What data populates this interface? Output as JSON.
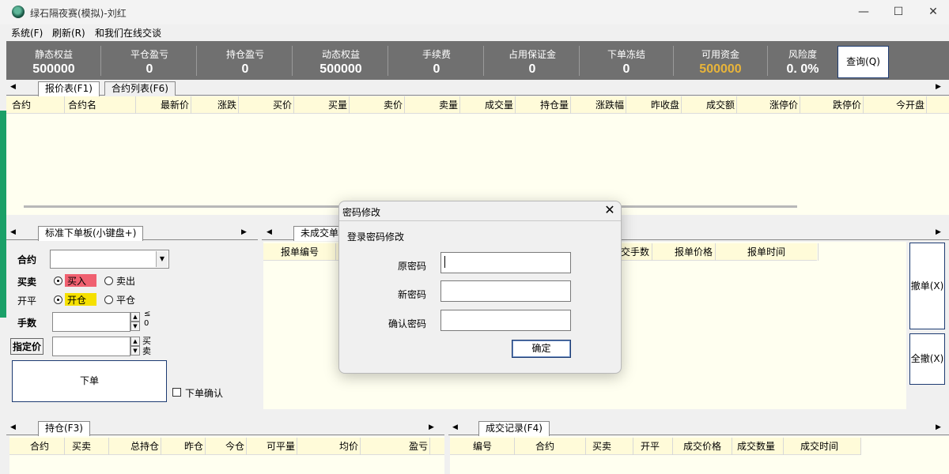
{
  "window": {
    "title": "绿石隔夜赛(模拟)-刘红",
    "minimize": "—",
    "maximize": "☐",
    "close": "✕"
  },
  "menu": [
    "系统(F)",
    "刷新(R)",
    "和我们在线交谈"
  ],
  "stats": [
    {
      "label": "静态权益",
      "value": "500000"
    },
    {
      "label": "平仓盈亏",
      "value": "0"
    },
    {
      "label": "持仓盈亏",
      "value": "0"
    },
    {
      "label": "动态权益",
      "value": "500000"
    },
    {
      "label": "手续费",
      "value": "0"
    },
    {
      "label": "占用保证金",
      "value": "0"
    },
    {
      "label": "下单冻结",
      "value": "0"
    },
    {
      "label": "可用资金",
      "value": "500000"
    },
    {
      "label": "风险度",
      "value": "0. 0%"
    }
  ],
  "colors": {
    "available_funds": "#e8b43a",
    "buy_highlight": "#f06070",
    "open_highlight": "#f5e000"
  },
  "query_button": "查询(Q)",
  "quote": {
    "tabs": [
      "报价表(F1)",
      "合约列表(F6)"
    ],
    "columns": [
      "合约",
      "合约名",
      "最新价",
      "涨跌",
      "买价",
      "买量",
      "卖价",
      "卖量",
      "成交量",
      "持仓量",
      "涨跌幅",
      "昨收盘",
      "成交额",
      "涨停价",
      "跌停价",
      "今开盘"
    ]
  },
  "order_board": {
    "tab": "标准下单板(小键盘+)",
    "contract_label": "合约",
    "side_label": "买卖",
    "buy": "买入",
    "sell": "卖出",
    "openclose_label": "开平",
    "open": "开仓",
    "close": "平仓",
    "qty_label": "手数",
    "qty_hint": "≤\n0",
    "price_label": "指定价",
    "price_hint": "买\n卖",
    "submit": "下单",
    "confirm": "下单确认"
  },
  "pending": {
    "tab": "未成交单",
    "columns": [
      "报单编号",
      "交手数",
      "报单价格",
      "报单时间"
    ],
    "cancel": "撤单(X)",
    "cancel_all": "全撤(X)"
  },
  "positions": {
    "tab": "持仓(F3)",
    "columns": [
      "合约",
      "买卖",
      "总持仓",
      "昨仓",
      "今仓",
      "可平量",
      "均价",
      "盈亏"
    ]
  },
  "trades": {
    "tab": "成交记录(F4)",
    "columns": [
      "编号",
      "合约",
      "买卖",
      "开平",
      "成交价格",
      "成交数量",
      "成交时间"
    ]
  },
  "dialog": {
    "title": "密码修改",
    "subtitle": "登录密码修改",
    "old_label": "原密码",
    "new_label": "新密码",
    "confirm_label": "确认密码",
    "ok": "确定",
    "close": "✕"
  }
}
